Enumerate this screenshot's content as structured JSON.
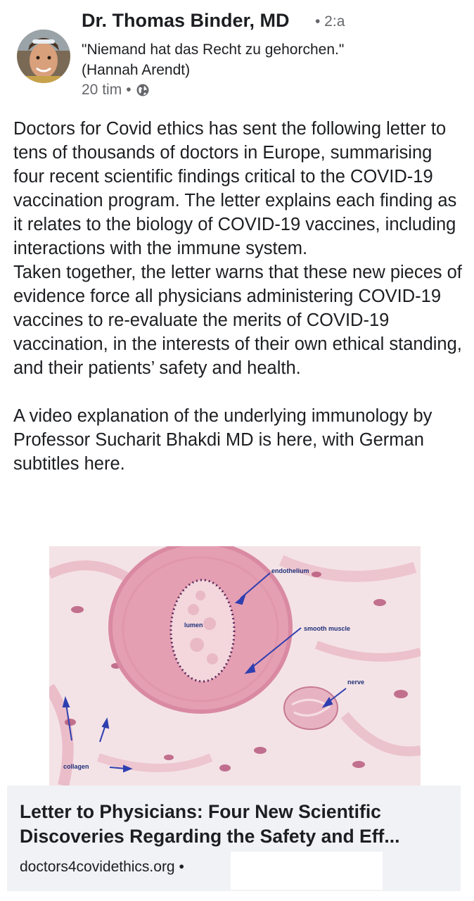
{
  "post": {
    "author": {
      "name": "Dr. Thomas Binder, MD",
      "extra": "• 2:a",
      "bio": "\"Niemand hat das Recht zu gehorchen.\" (Hannah Arendt)",
      "timestamp": "20 tim",
      "separator": "•",
      "avatar_icon": "avatar-photo",
      "audience_icon": "globe-icon"
    },
    "body": {
      "paragraph_1": "Doctors for Covid ethics has sent the following letter to tens of thousands of doctors in Europe, summarising four recent scientific findings critical to the COVID-19 vaccination program. The letter explains each finding as it relates to the biology of COVID-19 vaccines, including interactions with the immune system.",
      "paragraph_2": "Taken together, the letter warns that these new pieces of evidence force all physicians administering COVID-19 vaccines to re-evaluate the merits of COVID-19 vaccination, in the interests of their own ethical standing, and their patients’ safety and health.",
      "paragraph_3": "A video explanation of the underlying immunology by Professor Sucharit Bhakdi MD is here, with German subtitles here."
    },
    "link_preview": {
      "image_labels": {
        "endothelium": "endothelium",
        "lumen": "lumen",
        "smooth_muscle": "smooth muscle",
        "nerve": "nerve",
        "collagen": "collagen"
      },
      "title": "Letter to Physicians: Four New Scientific Discoveries Regarding the Safety and Eff...",
      "domain": "doctors4covidethics.org",
      "domain_separator": "•"
    }
  },
  "colors": {
    "text_primary": "#1c1e21",
    "text_secondary": "#65676b",
    "caption_background": "#f0f2f5",
    "label_color": "#20307a",
    "tissue_pink": "#e9a7b6"
  }
}
